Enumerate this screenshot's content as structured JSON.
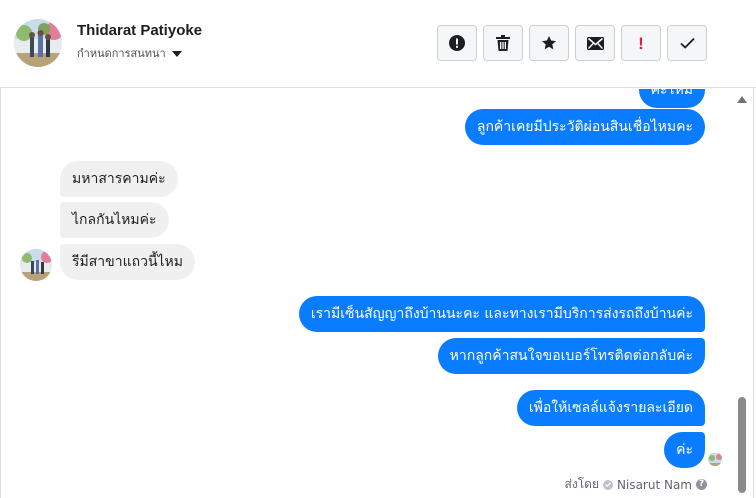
{
  "contact": {
    "name": "Thidarat Patiyoke",
    "subtitle": "กำหนดการสนทนา"
  },
  "actions": [
    {
      "icon": "alert-circle-icon"
    },
    {
      "icon": "trash-icon"
    },
    {
      "icon": "star-icon"
    },
    {
      "icon": "envelope-icon"
    },
    {
      "icon": "exclamation-icon",
      "label": "!"
    },
    {
      "icon": "checkmark-icon"
    }
  ],
  "messages": {
    "partial_top": "ค่ะไหม",
    "out_1": "ลูกค้าเคยมีประวัติผ่อนสินเชื่อไหมคะ",
    "in_1": "มหาสารคามค่ะ",
    "in_2": "ไกลกันไหมค่ะ",
    "in_3": "รีมีสาขาแถวนี้ไหม",
    "out_2": "เรามีเซ็นสัญญาถึงบ้านนะคะ และทางเรามีบริการส่งรถถึงบ้านค่ะ",
    "out_3": "หากลูกค้าสนใจขอเบอร์โทรติดต่อกลับค่ะ",
    "out_4": "เพื่อให้เซลล์แจ้งรายละเอียด",
    "out_5": "ค่ะ"
  },
  "footer": {
    "sent_by_label": "ส่งโดย",
    "sender_name": "Nisarut Nam"
  },
  "colors": {
    "outgoing_bubble": "#0a7cff",
    "incoming_bubble": "#f1f0f0",
    "alert_red": "#e41e3f"
  }
}
